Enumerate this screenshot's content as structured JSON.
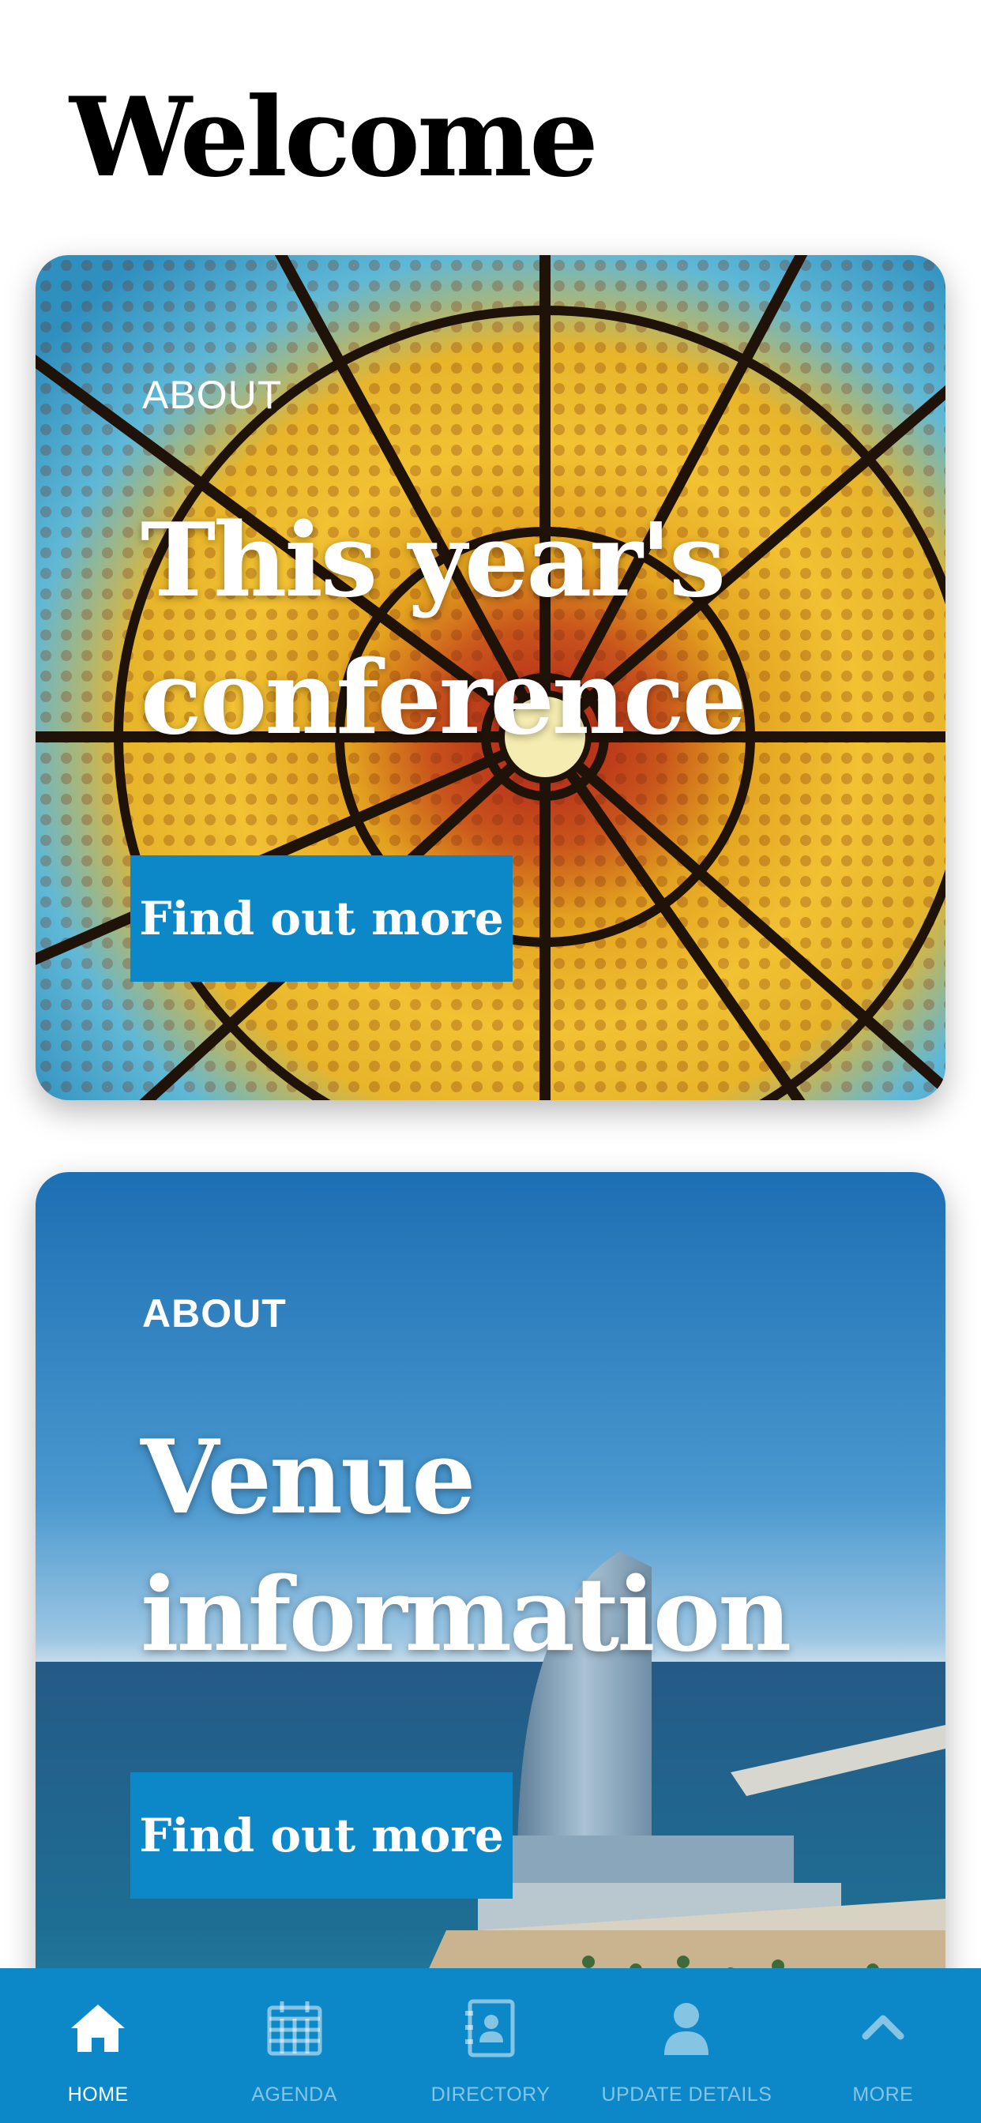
{
  "page": {
    "title": "Welcome"
  },
  "cards": [
    {
      "eyebrow": "ABOUT",
      "title": "This year's conference",
      "cta": "Find out more"
    },
    {
      "eyebrow": "ABOUT",
      "title": "Venue information",
      "cta": "Find out more"
    }
  ],
  "tabbar": {
    "items": [
      {
        "label": "HOME",
        "icon": "home-icon",
        "active": true
      },
      {
        "label": "AGENDA",
        "icon": "calendar-icon",
        "active": false
      },
      {
        "label": "DIRECTORY",
        "icon": "address-book-icon",
        "active": false
      },
      {
        "label": "UPDATE DETAILS",
        "icon": "user-icon",
        "active": false
      },
      {
        "label": "MORE",
        "icon": "chevron-up-icon",
        "active": false
      }
    ]
  },
  "colors": {
    "accent": "#0c88c9",
    "background": "#ffffff"
  }
}
